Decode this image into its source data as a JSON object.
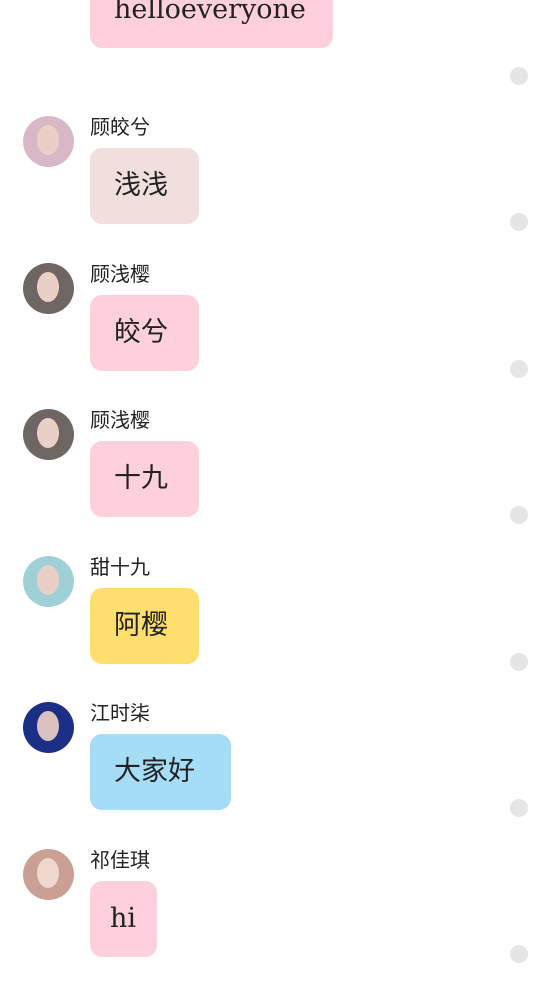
{
  "partial_top_message": {
    "text": "helloeveryone",
    "bubble_color": "#fdd0db"
  },
  "messages": [
    {
      "sender": "顾皎兮",
      "text": "浅浅",
      "bubble_color": "#f1dfdd",
      "avatar_color": "#d8b7c6"
    },
    {
      "sender": "顾浅樱",
      "text": "皎兮",
      "bubble_color": "#fdd0db",
      "avatar_color": "#6f6664"
    },
    {
      "sender": "顾浅樱",
      "text": "十九",
      "bubble_color": "#fdd0db",
      "avatar_color": "#6f6664"
    },
    {
      "sender": "甜十九",
      "text": "阿樱",
      "bubble_color": "#fede6c",
      "avatar_color": "#9fd0d6"
    },
    {
      "sender": "江时柒",
      "text": "大家好",
      "bubble_color": "#a5ddf6",
      "avatar_color": "#1c2f86"
    },
    {
      "sender": "祁佳琪",
      "text": "hi",
      "bubble_color": "#fdd0db",
      "avatar_color": "#c9a093"
    }
  ],
  "colors": {
    "background": "#ffffff",
    "status_dot": "#e5e5e5",
    "text": "#222222"
  },
  "icons": [
    "avatar",
    "message-status-dot"
  ]
}
